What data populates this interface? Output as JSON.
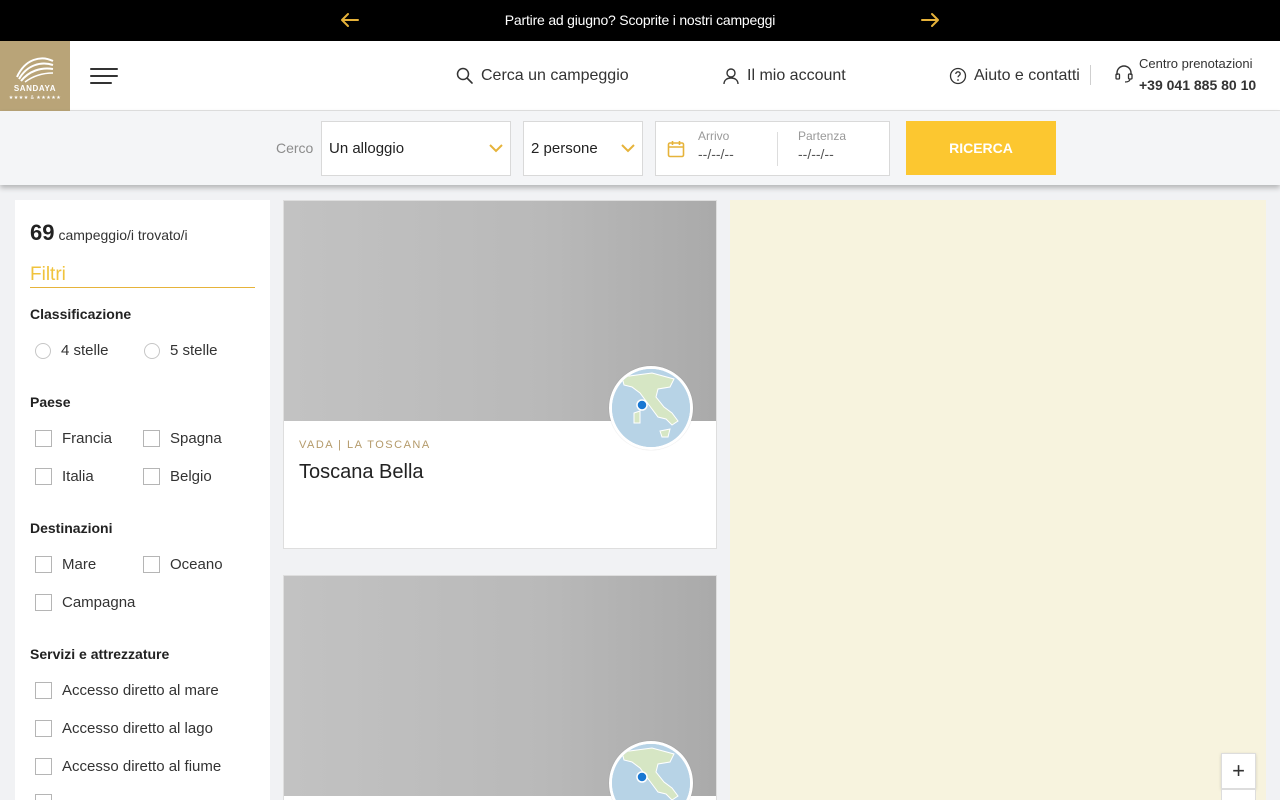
{
  "promo": {
    "text": "Partire ad giugno? Scoprite i nostri campeggi",
    "prev_icon": "arrow-left-icon",
    "next_icon": "arrow-right-icon",
    "accent": "#e6b23a"
  },
  "header": {
    "logo_text": "SANDAYA",
    "logo_stars": "★★★★ & ★★★★★",
    "nav": {
      "search_label": "Cerca un campeggio",
      "account_label": "Il mio account",
      "help_label": "Aiuto e contatti"
    },
    "booking": {
      "label": "Centro prenotazioni",
      "phone": "+39 041 885 80 10"
    }
  },
  "searchbar": {
    "label": "Cerco",
    "type_value": "Un alloggio",
    "people_value": "2 persone",
    "arrival_label": "Arrivo",
    "arrival_value": "--/--/--",
    "departure_label": "Partenza",
    "departure_value": "--/--/--",
    "search_button": "RICERCA",
    "button_color": "#fcc730"
  },
  "results": {
    "count": "69",
    "count_text": "campeggio/i trovato/i"
  },
  "filters": {
    "title": "Filtri",
    "classification": {
      "heading": "Classificazione",
      "options": [
        "4 stelle",
        "5 stelle"
      ]
    },
    "country": {
      "heading": "Paese",
      "options": [
        "Francia",
        "Spagna",
        "Italia",
        "Belgio"
      ]
    },
    "destinations": {
      "heading": "Destinazioni",
      "options": [
        "Mare",
        "Oceano",
        "Campagna"
      ]
    },
    "services": {
      "heading": "Servizi e attrezzature",
      "options": [
        "Accesso diretto al mare",
        "Accesso diretto al lago",
        "Accesso diretto al fiume"
      ]
    }
  },
  "cards": [
    {
      "location": "VADA | LA TOSCANA",
      "name": "Toscana Bella"
    },
    {
      "location": "",
      "name": ""
    }
  ],
  "map": {
    "zoom_in": "+",
    "background": "#f7f3de"
  }
}
